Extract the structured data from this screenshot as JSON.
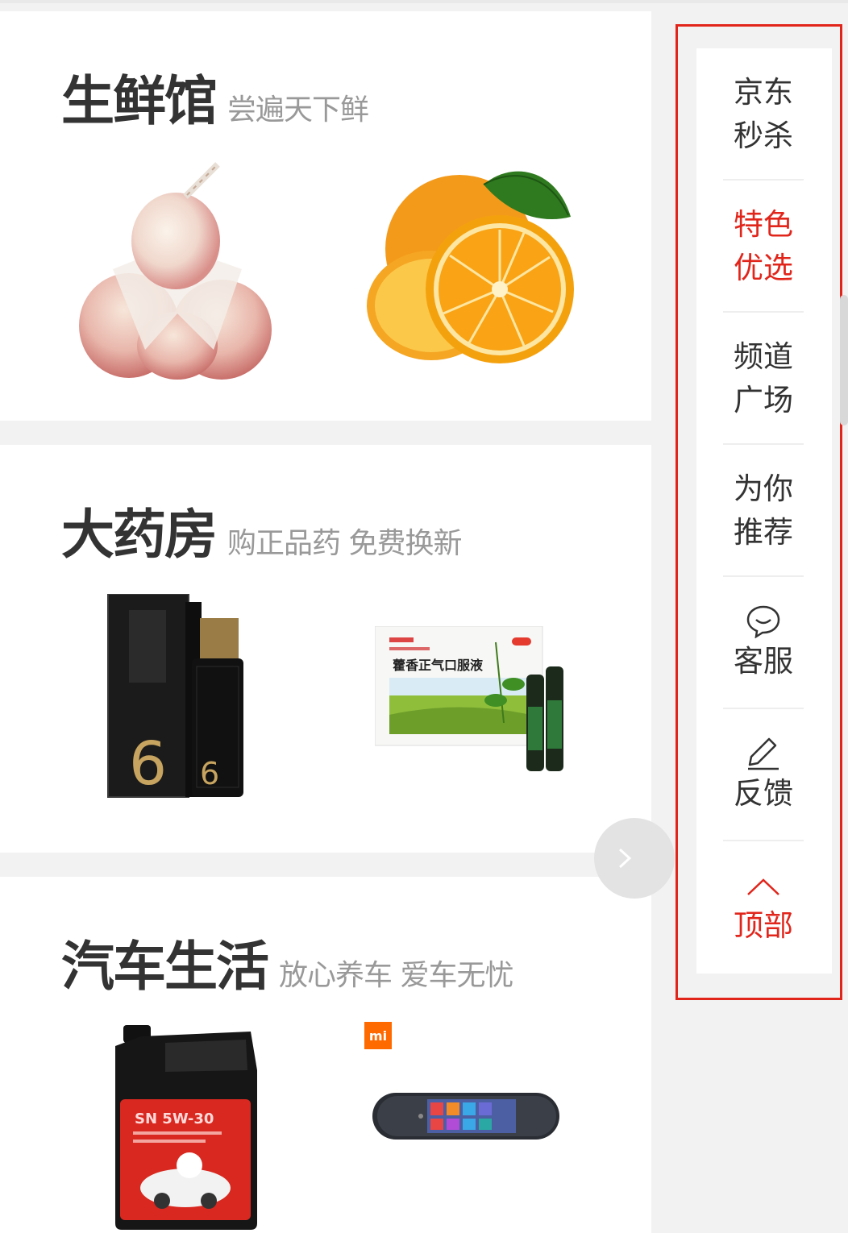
{
  "sections": [
    {
      "title": "生鲜馆",
      "subtitle": "尝遍天下鲜",
      "products": [
        "peach",
        "orange"
      ]
    },
    {
      "title": "大药房",
      "subtitle": "购正品药 免费换新",
      "products": [
        "dragon-wine",
        "medicine-box"
      ]
    },
    {
      "title": "汽车生活",
      "subtitle": "放心养车 爱车无忧",
      "products": [
        "engine-oil",
        "mi-rearview-mirror"
      ]
    }
  ],
  "product_labels": {
    "wine_bottle_big": "6",
    "wine_bottle_small": "6",
    "medicine_name": "藿香正气口服液",
    "oil_label": "SN 5W-30",
    "mi_logo": "mi"
  },
  "sidebar": {
    "items": [
      {
        "label": "京东秒杀",
        "icon": ""
      },
      {
        "label": "特色优选",
        "icon": "",
        "active": true
      },
      {
        "label": "频道广场",
        "icon": ""
      },
      {
        "label": "为你推荐",
        "icon": ""
      },
      {
        "label": "客服",
        "icon": "chat-bubble-icon"
      },
      {
        "label": "反馈",
        "icon": "pencil-icon"
      },
      {
        "label": "顶部",
        "icon": "chevron-up-icon"
      }
    ]
  },
  "colors": {
    "accent": "#e1251b",
    "text": "#333333",
    "subtext": "#999999"
  }
}
